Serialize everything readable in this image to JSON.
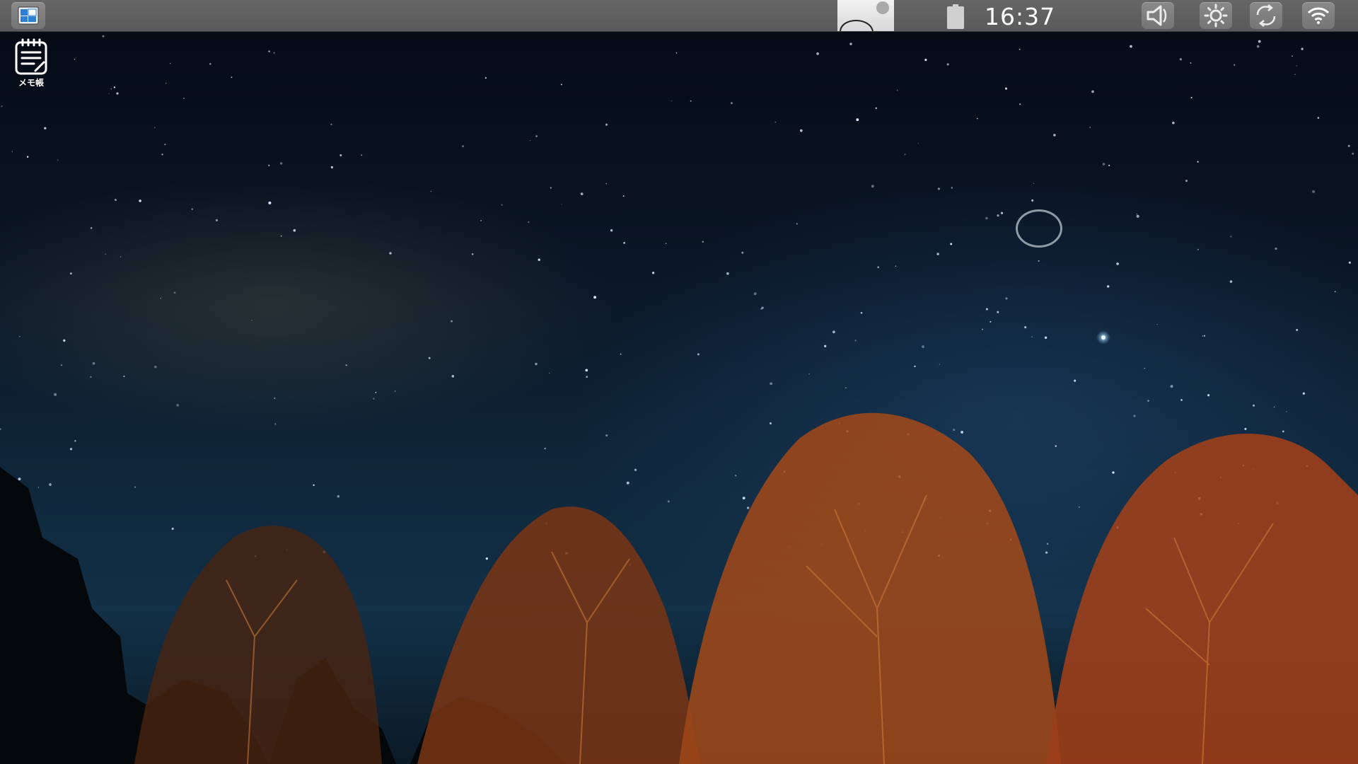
{
  "top_panel": {
    "menu_icon": "app-menu-icon",
    "avatar_icon": "user-avatar-icon",
    "battery_icon": "battery-icon",
    "clock": "16:37",
    "volume_icon": "volume-icon",
    "brightness_icon": "brightness-icon",
    "rotate_icon": "screen-rotate-icon",
    "wifi_icon": "wifi-icon"
  },
  "desktop": {
    "shortcuts": [
      {
        "label": "メモ帳",
        "icon": "notepad-icon"
      }
    ],
    "cursor_icon": "busy-cursor-icon"
  },
  "colors": {
    "panel": "#5f5f5f",
    "panel_button": "#808080",
    "menu_icon_blue": "#2f7fd0",
    "sky_top": "#050a14",
    "sky_mid": "#10283c",
    "tree_lit": "#c8551f"
  }
}
